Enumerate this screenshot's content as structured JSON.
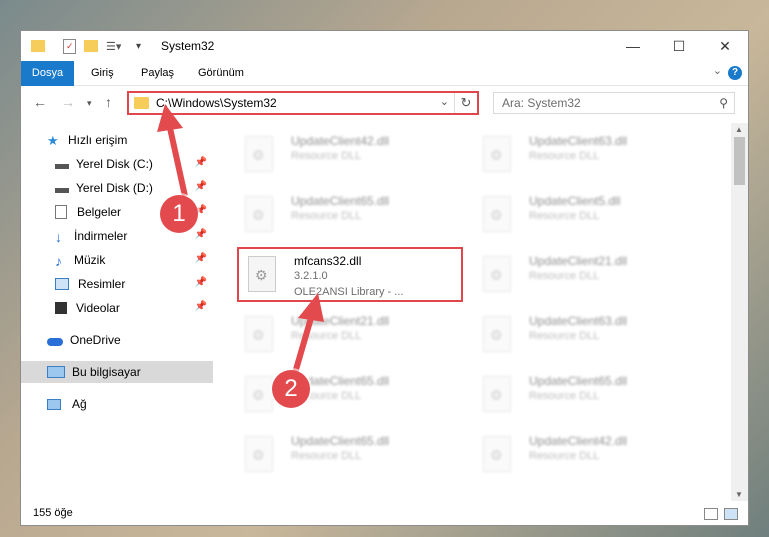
{
  "window": {
    "title": "System32"
  },
  "ribbon": {
    "tabs": [
      "Dosya",
      "Giriş",
      "Paylaş",
      "Görünüm"
    ],
    "help": "?"
  },
  "address": {
    "path": "C:\\Windows\\System32"
  },
  "search": {
    "placeholder": "Ara: System32"
  },
  "sidebar": {
    "items": [
      {
        "label": "Hızlı erişim"
      },
      {
        "label": "Yerel Disk (C:)"
      },
      {
        "label": "Yerel Disk (D:)"
      },
      {
        "label": "Belgeler"
      },
      {
        "label": "İndirmeler"
      },
      {
        "label": "Müzik"
      },
      {
        "label": "Resimler"
      },
      {
        "label": "Videolar"
      },
      {
        "label": "OneDrive"
      },
      {
        "label": "Bu bilgisayar"
      },
      {
        "label": "Ağ"
      }
    ]
  },
  "files": [
    {
      "name": "UpdateClient42.dll",
      "sub": "Resource DLL"
    },
    {
      "name": "UpdateClient63.dll",
      "sub": "Resource DLL"
    },
    {
      "name": "UpdateClient65.dll",
      "sub": "Resource DLL"
    },
    {
      "name": "UpdateClient5.dll",
      "sub": "Resource DLL"
    },
    {
      "name": "mfcans32.dll",
      "sub": "3.2.1.0",
      "sub2": "OLE2ANSI Library - ..."
    },
    {
      "name": "UpdateClient21.dll",
      "sub": "Resource DLL"
    },
    {
      "name": "UpdateClient21.dll",
      "sub": "Resource DLL"
    },
    {
      "name": "UpdateClient63.dll",
      "sub": "Resource DLL"
    },
    {
      "name": "UpdateClient65.dll",
      "sub": "Resource DLL"
    },
    {
      "name": "UpdateClient65.dll",
      "sub": "Resource DLL"
    },
    {
      "name": "UpdateClient65.dll",
      "sub": "Resource DLL"
    },
    {
      "name": "UpdateClient42.dll",
      "sub": "Resource DLL"
    }
  ],
  "status": {
    "count": "155 öğe"
  },
  "callouts": [
    "1",
    "2"
  ],
  "colors": {
    "accent": "#1979ca",
    "highlight": "#e0474c"
  }
}
